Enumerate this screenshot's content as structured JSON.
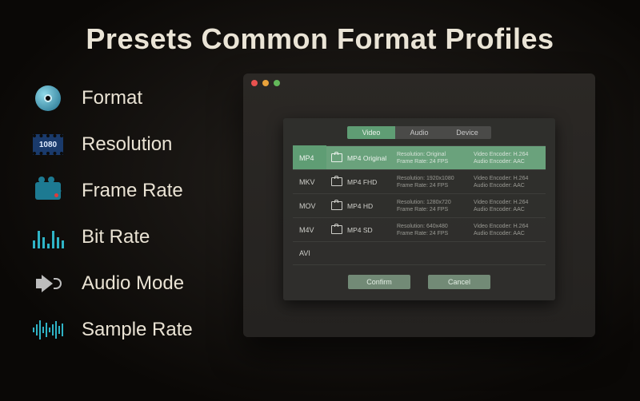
{
  "title": "Presets Common Format Profiles",
  "features": {
    "format": "Format",
    "resolution": "Resolution",
    "resolution_badge": "1080",
    "frame_rate": "Frame Rate",
    "bit_rate": "Bit Rate",
    "audio_mode": "Audio Mode",
    "sample_rate": "Sample Rate"
  },
  "dialog": {
    "tabs": {
      "video": "Video",
      "audio": "Audio",
      "device": "Device"
    },
    "formats": {
      "mp4": "MP4",
      "mkv": "MKV",
      "mov": "MOV",
      "m4v": "M4V",
      "avi": "AVI"
    },
    "presets": [
      {
        "name": "MP4 Original",
        "res": "Resolution: Original",
        "fps": "Frame Rate: 24 FPS",
        "venc": "Video Encoder: H.264",
        "aenc": "Audio Encoder: AAC"
      },
      {
        "name": "MP4 FHD",
        "res": "Resolution: 1920x1080",
        "fps": "Frame Rate: 24 FPS",
        "venc": "Video Encoder: H.264",
        "aenc": "Audio Encoder: AAC"
      },
      {
        "name": "MP4 HD",
        "res": "Resolution: 1280x720",
        "fps": "Frame Rate: 24 FPS",
        "venc": "Video Encoder: H.264",
        "aenc": "Audio Encoder: AAC"
      },
      {
        "name": "MP4 SD",
        "res": "Resolution: 640x480",
        "fps": "Frame Rate: 24 FPS",
        "venc": "Video Encoder: H.264",
        "aenc": "Audio Encoder: AAC"
      }
    ],
    "confirm": "Confirm",
    "cancel": "Cancel"
  }
}
